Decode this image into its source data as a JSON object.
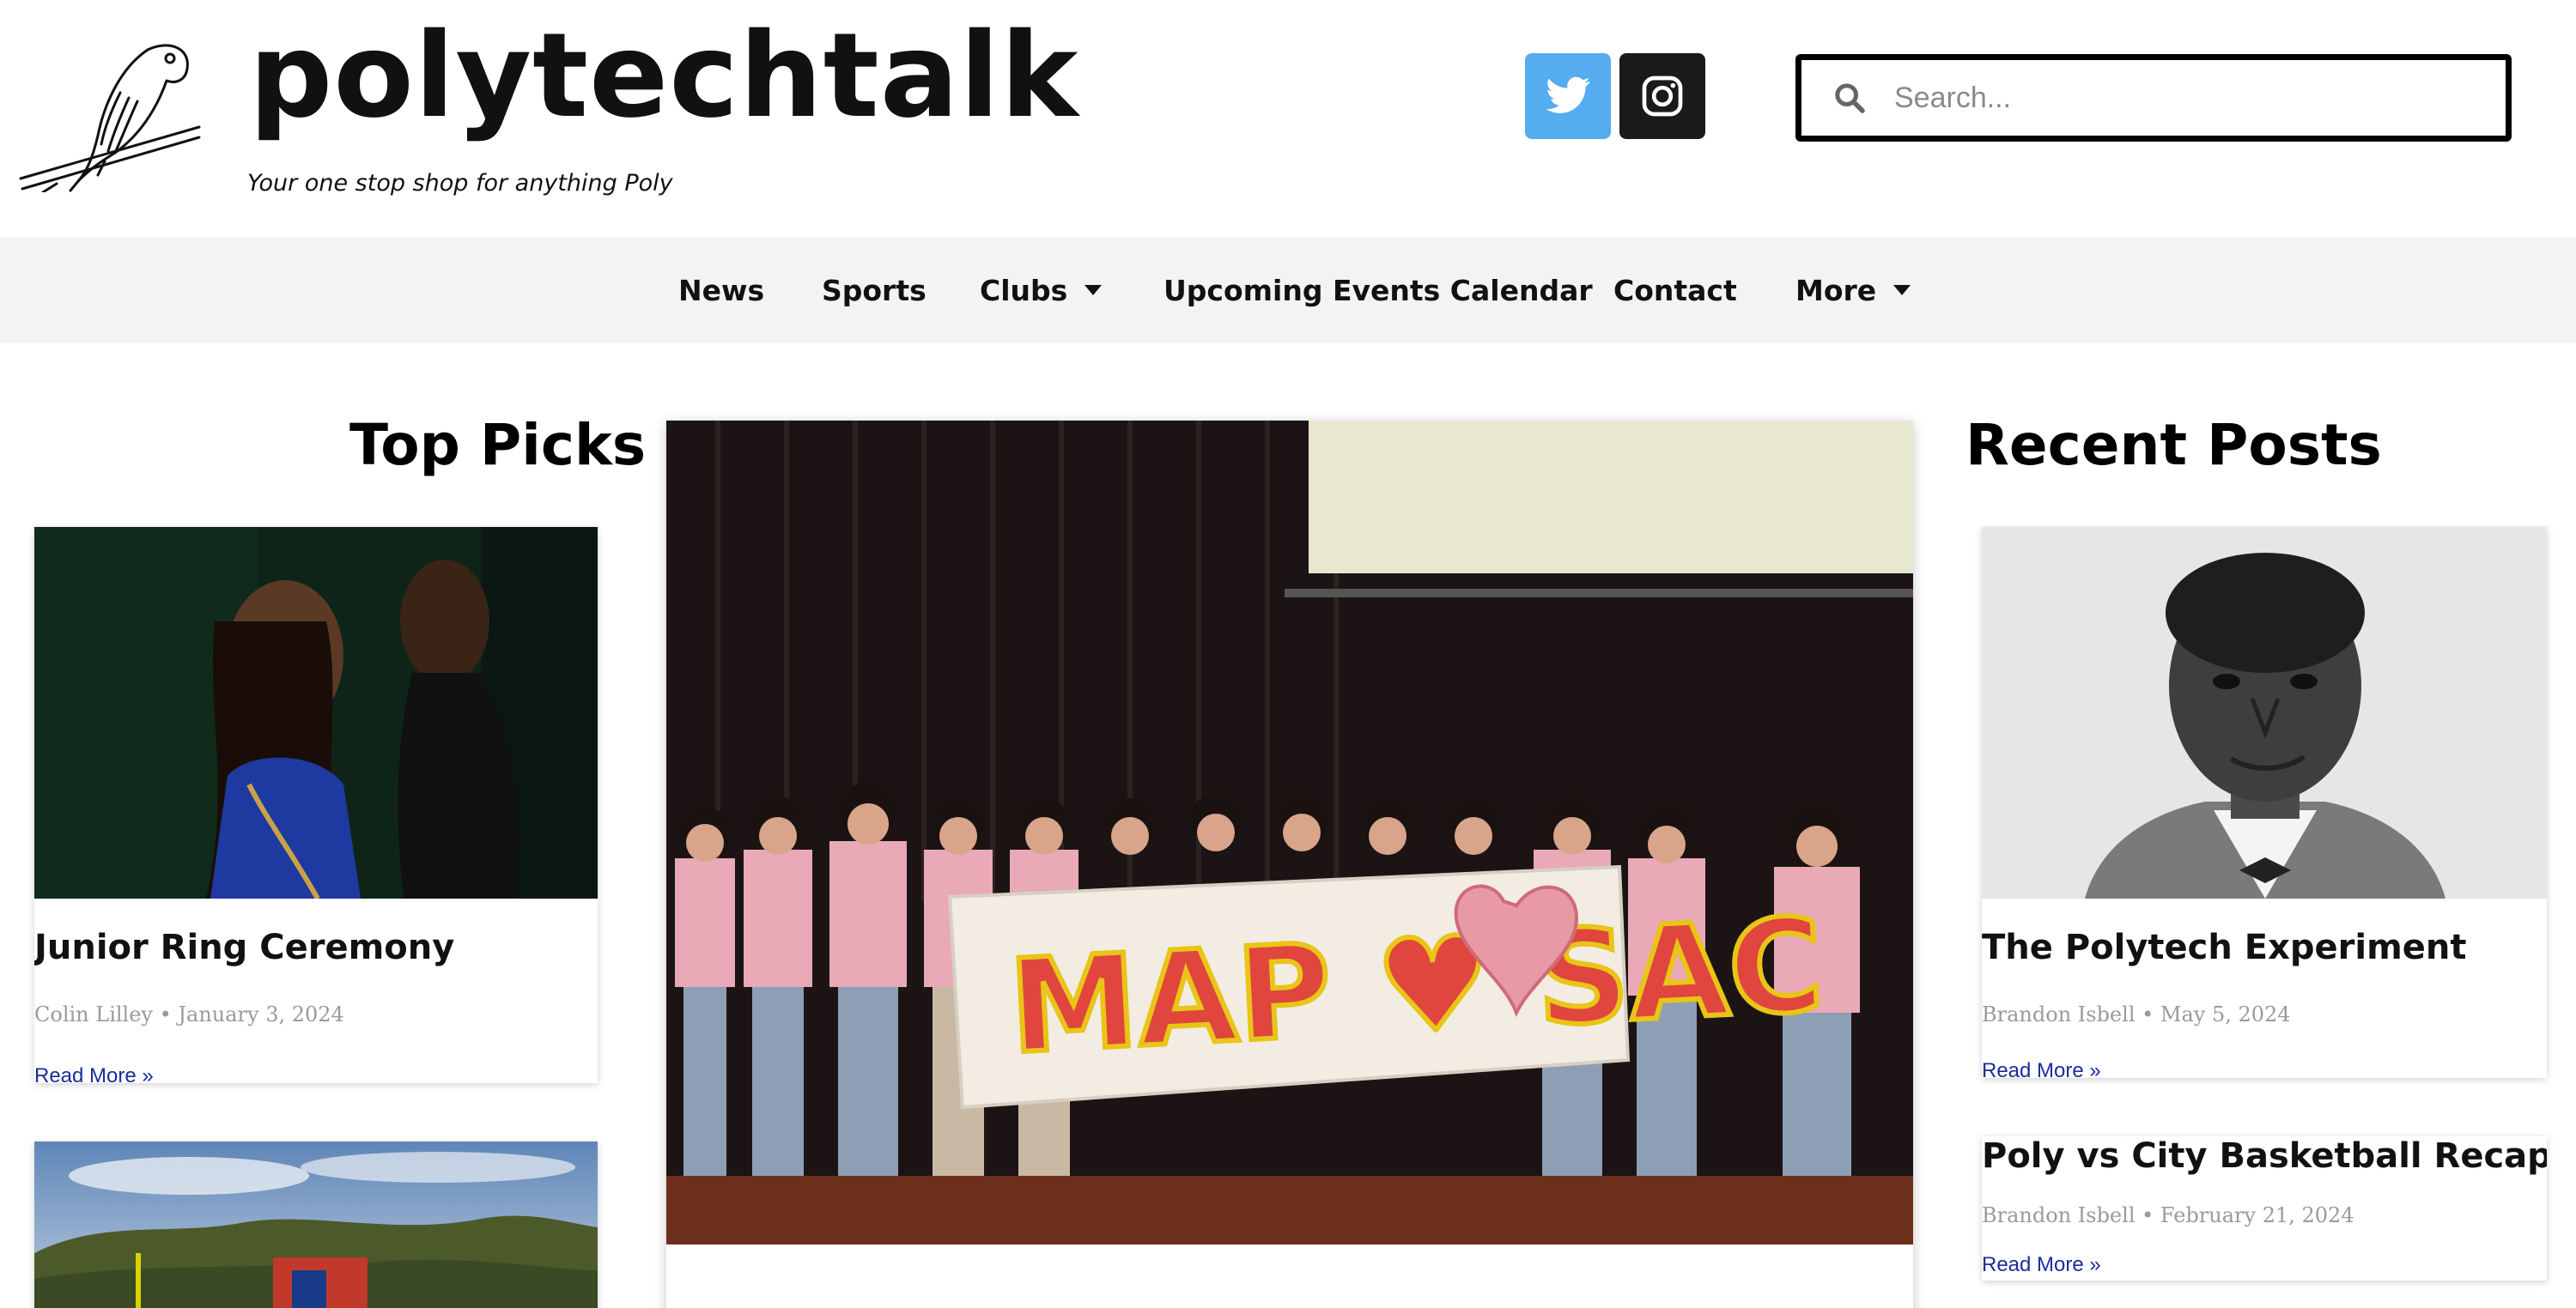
{
  "header": {
    "site_title": "polytechtalk",
    "tagline": "Your one stop shop for anything Poly",
    "search_placeholder": "Search..."
  },
  "nav": {
    "items": [
      {
        "label": "News"
      },
      {
        "label": "Sports"
      },
      {
        "label": "Clubs",
        "has_dropdown": true
      },
      {
        "label": "Upcoming Events Calendar"
      },
      {
        "label": "Contact"
      },
      {
        "label": "More",
        "has_dropdown": true
      }
    ]
  },
  "top_picks": {
    "heading": "Top Picks",
    "posts": [
      {
        "title": "Junior Ring Ceremony",
        "meta": "Colin Lilley • January 3, 2024",
        "read_more": "Read More »"
      }
    ]
  },
  "featured": {
    "banner_text": "MAP ♥ SAC"
  },
  "recent_posts": {
    "heading": "Recent Posts",
    "posts": [
      {
        "title": "The Polytech Experiment",
        "meta": "Brandon Isbell • May 5, 2024",
        "read_more": "Read More »"
      },
      {
        "title": "Poly vs City Basketball Recap",
        "meta": "Brandon Isbell • February 21, 2024",
        "read_more": "Read More »"
      }
    ]
  },
  "icons": [
    "search-icon",
    "twitter-icon",
    "instagram-icon",
    "parrot-logo-icon",
    "dropdown-caret-icon"
  ],
  "colors": {
    "twitter": "#55acee",
    "instagram": "#1a1a1a",
    "nav_bg": "#f2f3f5",
    "link": "#1a2c9c",
    "meta": "#9a9a9a"
  }
}
